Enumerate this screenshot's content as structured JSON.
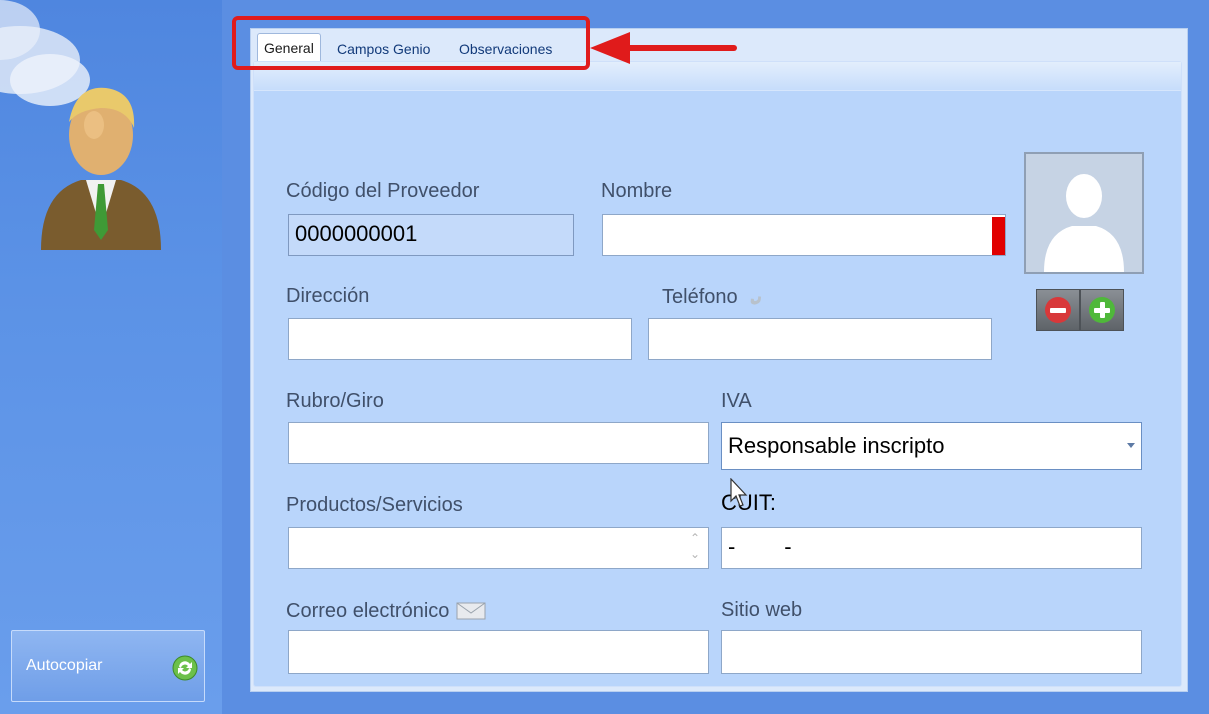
{
  "sidebar": {
    "autocopy_label": "Autocopiar",
    "icons": {
      "avatar": "businessman-avatar-icon",
      "autocopy": "sync-arrows-icon"
    }
  },
  "tabs": [
    {
      "label": "General",
      "active": true
    },
    {
      "label": "Campos Genio",
      "active": false
    },
    {
      "label": "Observaciones",
      "active": false
    }
  ],
  "form": {
    "codigo_label": "Código del Proveedor",
    "codigo_value": "0000000001",
    "nombre_label": "Nombre",
    "nombre_value": "",
    "direccion_label": "Dirección",
    "direccion_value": "",
    "telefono_label": "Teléfono",
    "telefono_value": "",
    "rubro_label": "Rubro/Giro",
    "rubro_value": "",
    "iva_label": "IVA",
    "iva_value": "Responsable inscripto",
    "productos_label": "Productos/Servicios",
    "productos_value": "",
    "cuit_label": "CUIT:",
    "cuit_value": "-        -",
    "correo_label": "Correo electrónico",
    "correo_value": "",
    "sitio_label": "Sitio web",
    "sitio_value": ""
  },
  "colors": {
    "required": "#e10000",
    "highlight": "#e01b1b",
    "panel_bg": "#b9d5fb"
  }
}
